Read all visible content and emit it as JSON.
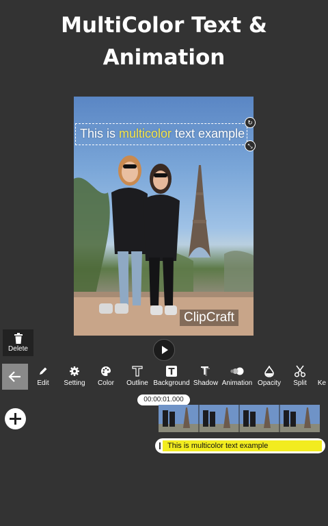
{
  "headline": {
    "line1": "MultiColor Text &",
    "line2": "Animation"
  },
  "preview": {
    "overlay_text": {
      "before": "This is ",
      "highlight": "multicolor",
      "after": " text example"
    },
    "watermark": "ClipCraft"
  },
  "actions": {
    "delete_label": "Delete"
  },
  "toolbar": {
    "items": [
      {
        "label": "Edit",
        "icon": "pencil-icon"
      },
      {
        "label": "Setting",
        "icon": "gear-icon"
      },
      {
        "label": "Color",
        "icon": "palette-icon"
      },
      {
        "label": "Outline",
        "icon": "text-outline-icon"
      },
      {
        "label": "Background",
        "icon": "text-background-icon"
      },
      {
        "label": "Shadow",
        "icon": "text-shadow-icon"
      },
      {
        "label": "Animation",
        "icon": "animation-icon"
      },
      {
        "label": "Opacity",
        "icon": "drop-icon"
      },
      {
        "label": "Split",
        "icon": "scissors-icon"
      },
      {
        "label": "Ke",
        "icon": "keyframe-icon"
      }
    ]
  },
  "timeline": {
    "time_display": "00:00:01.000",
    "text_clip_label": "This is multicolor text example"
  },
  "colors": {
    "background": "#333333",
    "highlight_text": "#f5e54a",
    "text_clip": "#f2ec1f"
  }
}
